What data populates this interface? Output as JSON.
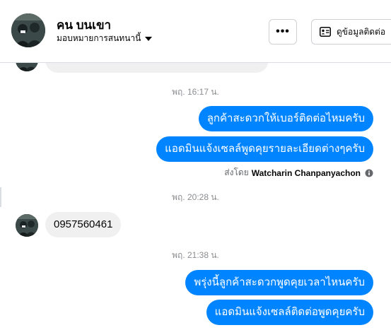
{
  "header": {
    "name": "คน บนเขา",
    "subtitle": "มอบหมายการสนทนานี้",
    "more_label": "•••",
    "contact_label": "ดูข้อมูลติดต่อ"
  },
  "conversation": {
    "time_1": "พฤ. 16:17 น.",
    "out_1": "ลูกค้าสะดวกให้เบอร์ติดต่อไหมครับ",
    "out_2": "แอดมินแจ้งเซลล์พูดคุยรายละเอียดต่างๆครับ",
    "sent_by_prefix": "ส่งโดย",
    "sent_by_name": "Watcharin Chanpanyachon",
    "time_2": "พฤ. 20:28 น.",
    "in_1": "0957560461",
    "time_3": "พฤ. 21:38 น.",
    "out_3": "พรุ่งนี้ลูกค้าสะดวกพูดคุยเวลาไหนครับ",
    "out_4": "แอดมินแจ้งเซลล์ติดต่อพูดคุยครับ"
  },
  "colors": {
    "outgoing_bubble": "#0084ff",
    "incoming_bubble": "#f0f0f0",
    "timestamp": "#8a8d91"
  },
  "icons": {
    "more": "more-dots-icon",
    "contact": "contact-card-icon",
    "caret": "caret-down-icon",
    "info": "info-icon"
  }
}
